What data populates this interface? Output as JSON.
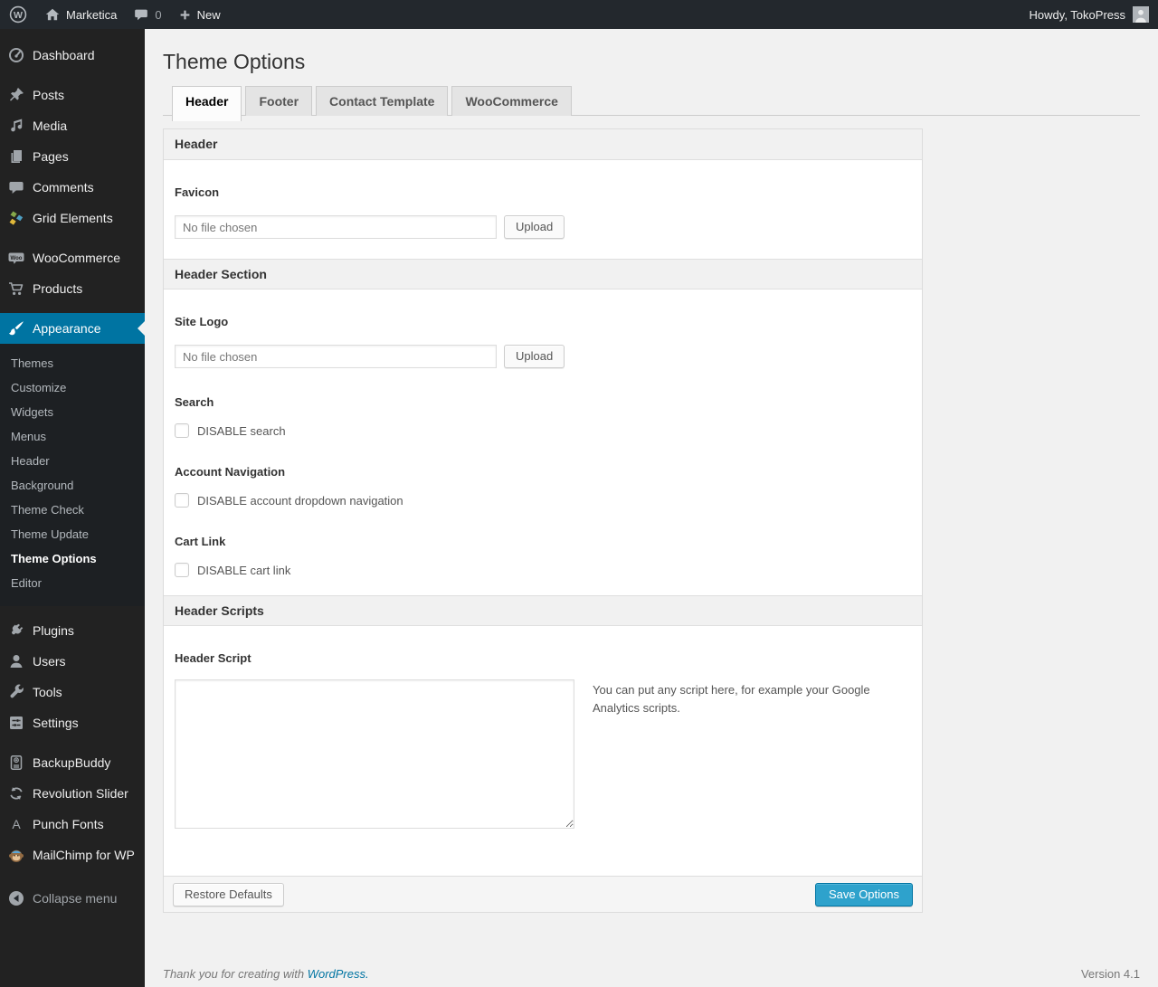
{
  "admin_bar": {
    "site_name": "Marketica",
    "comment_count": "0",
    "new_label": "New",
    "howdy": "Howdy, TokoPress"
  },
  "sidebar": {
    "group1": [
      {
        "label": "Dashboard"
      }
    ],
    "group2": [
      {
        "label": "Posts"
      },
      {
        "label": "Media"
      },
      {
        "label": "Pages"
      },
      {
        "label": "Comments"
      },
      {
        "label": "Grid Elements"
      }
    ],
    "group3": [
      {
        "label": "WooCommerce"
      },
      {
        "label": "Products"
      }
    ],
    "appearance": {
      "label": "Appearance",
      "submenu": [
        {
          "label": "Themes"
        },
        {
          "label": "Customize"
        },
        {
          "label": "Widgets"
        },
        {
          "label": "Menus"
        },
        {
          "label": "Header"
        },
        {
          "label": "Background"
        },
        {
          "label": "Theme Check"
        },
        {
          "label": "Theme Update"
        },
        {
          "label": "Theme Options",
          "current": true
        },
        {
          "label": "Editor"
        }
      ]
    },
    "group4": [
      {
        "label": "Plugins"
      },
      {
        "label": "Users"
      },
      {
        "label": "Tools"
      },
      {
        "label": "Settings"
      }
    ],
    "group5": [
      {
        "label": "BackupBuddy"
      },
      {
        "label": "Revolution Slider"
      },
      {
        "label": "Punch Fonts"
      },
      {
        "label": "MailChimp for WP"
      }
    ],
    "collapse_label": "Collapse menu"
  },
  "page": {
    "title": "Theme Options",
    "tabs": [
      {
        "label": "Header",
        "active": true
      },
      {
        "label": "Footer",
        "active": false
      },
      {
        "label": "Contact Template",
        "active": false
      },
      {
        "label": "WooCommerce",
        "active": false
      }
    ]
  },
  "panel": {
    "section_header": "Header",
    "section_header_section": "Header Section",
    "section_header_scripts": "Header Scripts",
    "favicon": {
      "label": "Favicon",
      "value": "No file chosen",
      "button": "Upload"
    },
    "site_logo": {
      "label": "Site Logo",
      "value": "No file chosen",
      "button": "Upload"
    },
    "search": {
      "label": "Search",
      "checkbox_label": "DISABLE search",
      "checked": false
    },
    "account_nav": {
      "label": "Account Navigation",
      "checkbox_label": "DISABLE account dropdown navigation",
      "checked": false
    },
    "cart_link": {
      "label": "Cart Link",
      "checkbox_label": "DISABLE cart link",
      "checked": false
    },
    "header_script": {
      "label": "Header Script",
      "value": "",
      "help": "You can put any script here, for example your Google Analytics scripts."
    },
    "restore_button": "Restore Defaults",
    "save_button": "Save Options"
  },
  "footer": {
    "thanks_text": "Thank you for creating with",
    "thanks_link": "WordPress.",
    "version": "Version 4.1"
  },
  "colors": {
    "menu_highlight": "#0074a2",
    "primary_button": "#2ea2cc",
    "link": "#0074a2",
    "admin_bar_bg": "#23282d",
    "sidebar_bg": "#222222"
  }
}
